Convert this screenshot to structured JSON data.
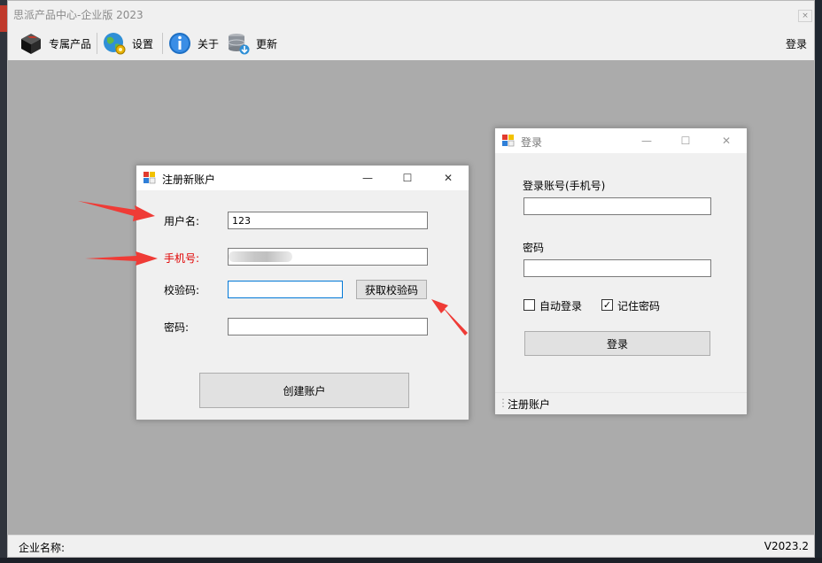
{
  "app": {
    "title": "思派产品中心-企业版 2023",
    "close_glyph": "×"
  },
  "toolbar": {
    "items": [
      {
        "label": "专属产品",
        "icon": "black-box-icon"
      },
      {
        "label": "设置",
        "icon": "globe-gear-icon"
      },
      {
        "label": "关于",
        "icon": "info-icon"
      },
      {
        "label": "更新",
        "icon": "database-update-icon"
      }
    ],
    "login_label": "登录"
  },
  "statusbar": {
    "company_label": "企业名称:",
    "version": "V2023.2"
  },
  "register_window": {
    "title": "注册新账户",
    "username_label": "用户名:",
    "username_value": "123",
    "phone_label": "手机号:",
    "verify_label": "校验码:",
    "verify_value": "",
    "get_code_label": "获取校验码",
    "password_label": "密码:",
    "password_value": "",
    "create_label": "创建账户",
    "controls": {
      "minimize": "—",
      "maximize": "☐",
      "close": "✕"
    }
  },
  "login_window": {
    "title": "登录",
    "account_label": "登录账号(手机号)",
    "account_value": "",
    "password_label": "密码",
    "password_value": "",
    "auto_login_label": "自动登录",
    "auto_login_checked": false,
    "remember_label": "记住密码",
    "remember_checked": true,
    "login_label": "登录",
    "register_link": "注册账户",
    "controls": {
      "minimize": "—",
      "maximize": "☐",
      "close": "✕"
    }
  },
  "colors": {
    "mdi_background": "#ababab",
    "window_background": "#f0f0f0",
    "highlight_label": "#e00000",
    "arrow": "#ef3b36",
    "focus_border": "#0078d7"
  },
  "checkmark_glyph": "✓"
}
